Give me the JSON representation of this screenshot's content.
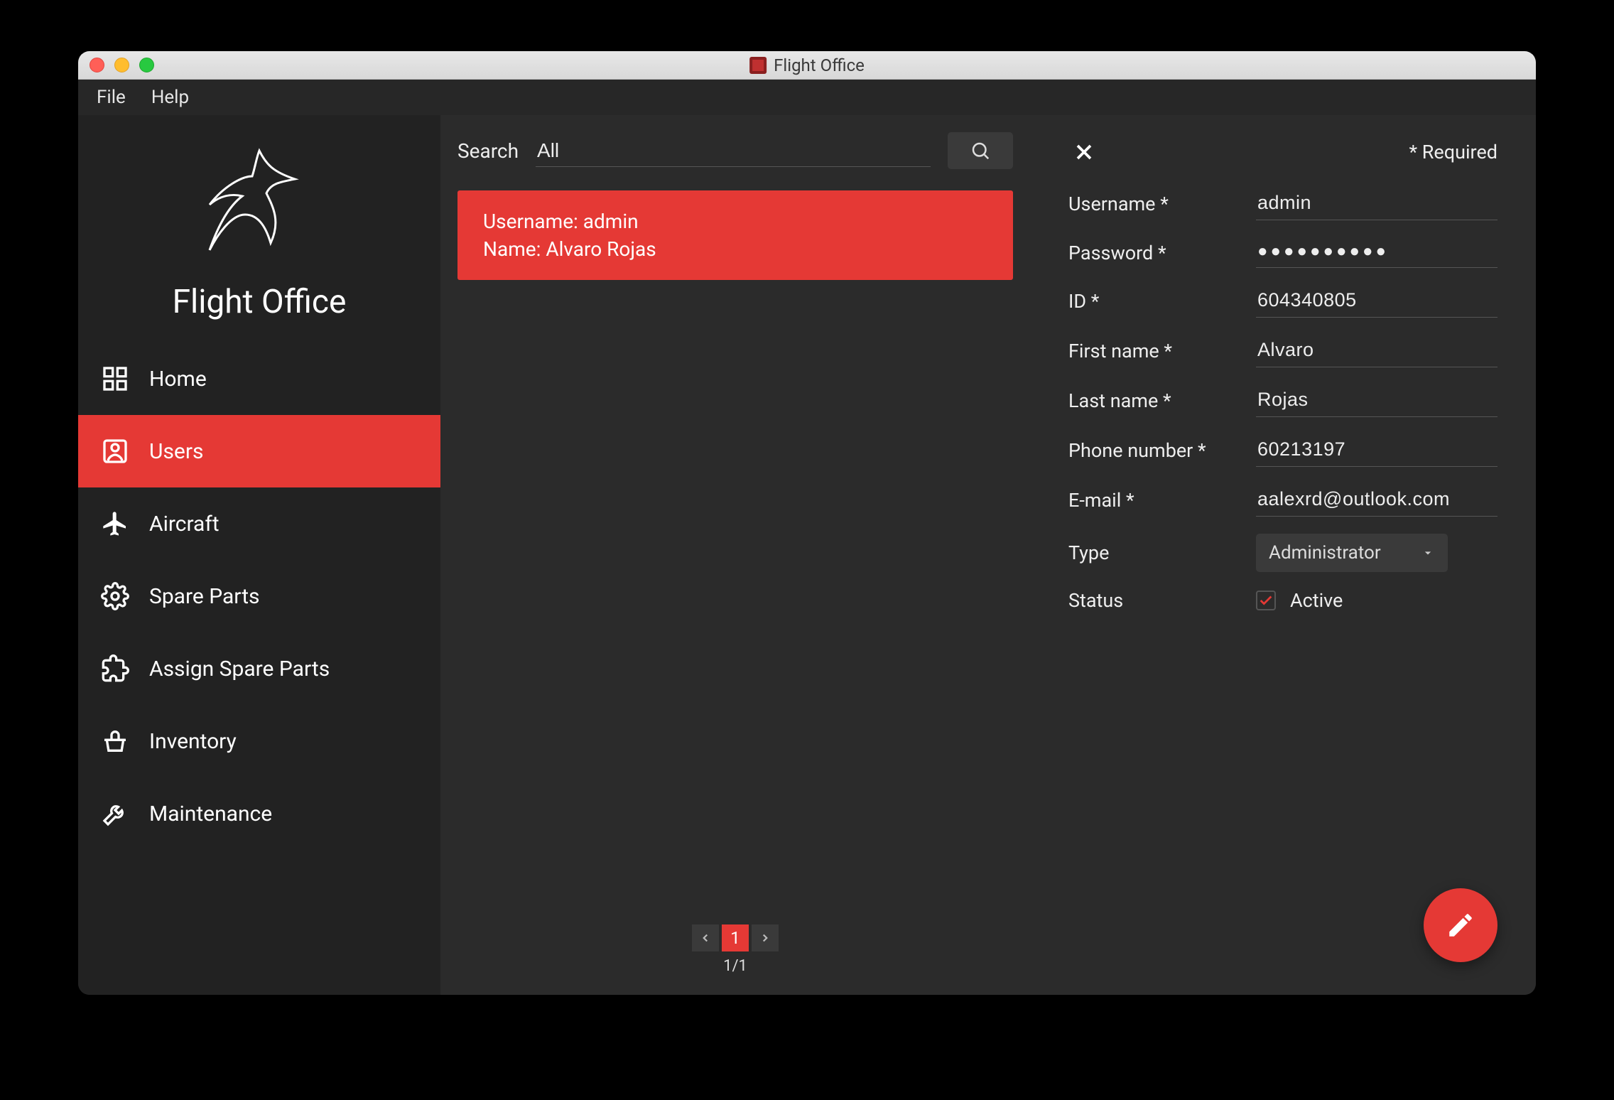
{
  "window": {
    "title": "Flight Office"
  },
  "menubar": {
    "file": "File",
    "help": "Help"
  },
  "brand": {
    "title": "Flight Office"
  },
  "sidebar": {
    "items": [
      {
        "label": "Home"
      },
      {
        "label": "Users"
      },
      {
        "label": "Aircraft"
      },
      {
        "label": "Spare Parts"
      },
      {
        "label": "Assign Spare Parts"
      },
      {
        "label": "Inventory"
      },
      {
        "label": "Maintenance"
      }
    ],
    "active_index": 1
  },
  "search": {
    "label": "Search",
    "value": "All"
  },
  "results": [
    {
      "line1": "Username: admin",
      "line2": "Name: Alvaro Rojas"
    }
  ],
  "pager": {
    "current": "1",
    "summary": "1/1"
  },
  "detail": {
    "required_note": "* Required",
    "labels": {
      "username": "Username *",
      "password": "Password *",
      "id": "ID *",
      "first_name": "First name *",
      "last_name": "Last name *",
      "phone": "Phone number *",
      "email": "E-mail *",
      "type": "Type",
      "status": "Status"
    },
    "values": {
      "username": "admin",
      "password": "●●●●●●●●●●",
      "id": "604340805",
      "first_name": "Alvaro",
      "last_name": "Rojas",
      "phone": "60213197",
      "email": "aalexrd@outlook.com",
      "type": "Administrator",
      "status_text": "Active",
      "status_checked": true
    }
  },
  "colors": {
    "accent": "#e53935",
    "bg": "#2b2b2b",
    "sidebar": "#222222"
  }
}
